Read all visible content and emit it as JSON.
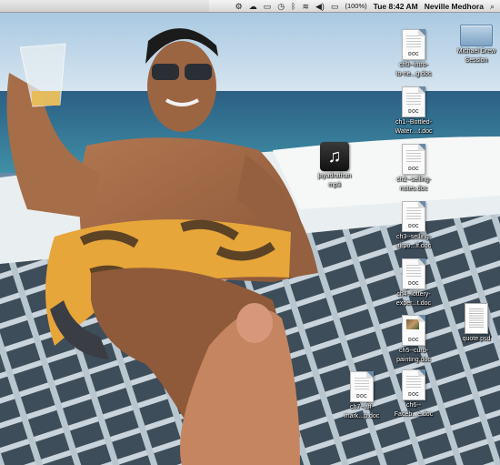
{
  "menubar": {
    "battery": "(100%)",
    "clock": "Tue 8:42 AM",
    "user": "Neville Medhora",
    "status_icons": [
      "gear-icon",
      "cloud-icon",
      "display-icon",
      "time-machine-icon",
      "bluetooth-icon",
      "wifi-icon",
      "volume-icon",
      "battery-icon",
      "spotlight-icon"
    ]
  },
  "desktop": {
    "items": [
      {
        "name": "desktop-icon-ch0",
        "kind": "doc",
        "line1": "ch0--intro-",
        "line2": "to-ne...g.doc",
        "badge": "DOC"
      },
      {
        "name": "desktop-icon-ch1",
        "kind": "doc",
        "line1": "ch1--Bottled-",
        "line2": "Water....t.doc",
        "badge": "DOC"
      },
      {
        "name": "desktop-icon-ch2",
        "kind": "doc",
        "line1": "ch2--selling-",
        "line2": "notes.doc",
        "badge": "DOC"
      },
      {
        "name": "desktop-icon-ch3",
        "kind": "doc",
        "line1": "ch3--selling-",
        "line2": "airpo...ff.doc",
        "badge": "DOC"
      },
      {
        "name": "desktop-icon-ch4",
        "kind": "doc",
        "line1": "ch4--lottery-",
        "line2": "exper...t.doc",
        "badge": "DOC"
      },
      {
        "name": "desktop-icon-ch5",
        "kind": "doc-thumb",
        "line1": "ch5--curb-",
        "line2": "painting.doc",
        "badge": "DOC"
      },
      {
        "name": "desktop-icon-ch6",
        "kind": "doc",
        "line1": "ch6--",
        "line2": "Faceb...e.doc",
        "badge": "DOC"
      },
      {
        "name": "desktop-icon-ch7",
        "kind": "doc",
        "line1": "ch7--aff-",
        "line2": "mark...p.doc",
        "badge": "DOC"
      },
      {
        "name": "desktop-icon-mp3",
        "kind": "music",
        "line1": "jayadrathan",
        "line2": "mp3",
        "badge": ""
      },
      {
        "name": "desktop-icon-quote",
        "kind": "psd",
        "line1": "quote.psd",
        "line2": "",
        "badge": ""
      },
      {
        "name": "desktop-icon-drive",
        "kind": "drive",
        "line1": "Michael Drew",
        "line2": "Session",
        "badge": ""
      }
    ]
  },
  "colors": {
    "sky": "#b9d3e6",
    "sea": "#2f6f8f",
    "net": "#6f8799",
    "shorts": "#e7a63a"
  }
}
